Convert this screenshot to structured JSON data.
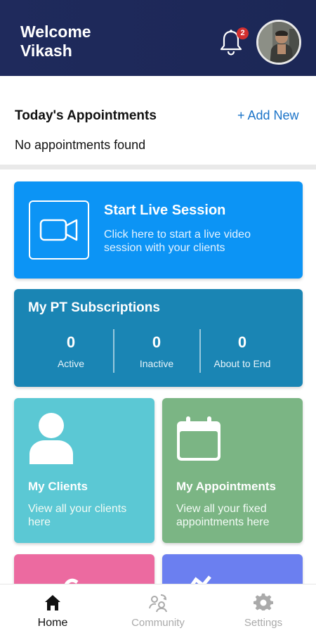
{
  "header": {
    "welcome_line1": "Welcome",
    "welcome_line2": "Vikash",
    "notification_count": "2"
  },
  "appointments": {
    "title": "Today's Appointments",
    "add_new_label": "+ Add New",
    "empty_text": "No appointments found"
  },
  "live_session": {
    "title": "Start Live Session",
    "description": "Click here to start a live video session with your clients"
  },
  "pt_subscriptions": {
    "title": "My PT Subscriptions",
    "stats": [
      {
        "value": "0",
        "label": "Active"
      },
      {
        "value": "0",
        "label": "Inactive"
      },
      {
        "value": "0",
        "label": "About to End"
      }
    ]
  },
  "tiles": {
    "clients": {
      "title": "My Clients",
      "description": "View all your clients here"
    },
    "appointments": {
      "title": "My Appointments",
      "description": "View all your fixed appointments here"
    }
  },
  "bottom_nav": {
    "items": [
      {
        "label": "Home",
        "icon": "home-icon",
        "active": true
      },
      {
        "label": "Community",
        "icon": "community-icon",
        "active": false
      },
      {
        "label": "Settings",
        "icon": "gear-icon",
        "active": false
      }
    ]
  },
  "colors": {
    "header_bg": "#1f2a5c",
    "live_card": "#0c94f5",
    "pt_card": "#1a85b4",
    "clients_tile": "#5bc8d4",
    "appointments_tile": "#7bb584",
    "pink_tile": "#ec6aa0",
    "purple_tile": "#6b7ff0",
    "link": "#1a73c8"
  }
}
